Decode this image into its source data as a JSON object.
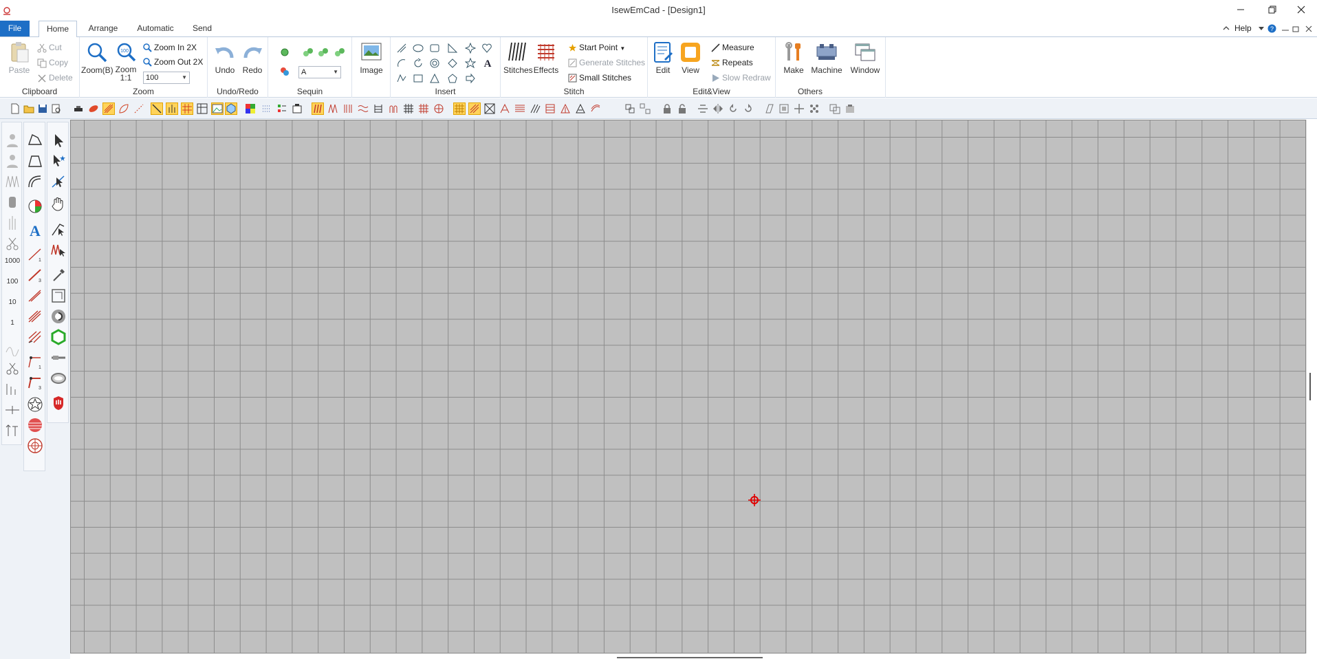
{
  "window": {
    "title": "IsewEmCad - [Design1]"
  },
  "menu": {
    "file": "File",
    "tabs": [
      "Home",
      "Arrange",
      "Automatic",
      "Send"
    ],
    "help": "Help"
  },
  "ribbon": {
    "clipboard": {
      "label": "Clipboard",
      "paste": "Paste",
      "cut": "Cut",
      "copy": "Copy",
      "delete": "Delete"
    },
    "zoom": {
      "label": "Zoom",
      "zoom_b": "Zoom(B)",
      "zoom_11": "Zoom 1:1",
      "zoom_in": "Zoom In 2X",
      "zoom_out": "Zoom Out 2X",
      "zoom_value": "100"
    },
    "undo_redo": {
      "label": "Undo/Redo",
      "undo": "Undo",
      "redo": "Redo"
    },
    "sequin": {
      "label": "Sequin",
      "value": "A"
    },
    "image": {
      "label": "Image"
    },
    "insert": {
      "label": "Insert"
    },
    "stitch": {
      "label": "Stitch",
      "stitches": "Stitches",
      "effects": "Effects",
      "start_point": "Start Point",
      "generate": "Generate Stitches",
      "small": "Small Stitches"
    },
    "edit_view": {
      "label": "Edit&View",
      "edit": "Edit",
      "view": "View",
      "measure": "Measure",
      "repeats": "Repeats",
      "slow_redraw": "Slow Redraw"
    },
    "others": {
      "label": "Others",
      "make": "Make",
      "machine": "Machine",
      "window": "Window"
    }
  },
  "lefttools": {
    "labels": [
      "1000",
      "100",
      "10",
      "1"
    ]
  },
  "colors": {
    "accent": "#1e6fc6",
    "canvas": "#c0c0c0",
    "grid": "#8c8c8c",
    "origin": "#e00000",
    "highlight": "#ffd35a"
  }
}
